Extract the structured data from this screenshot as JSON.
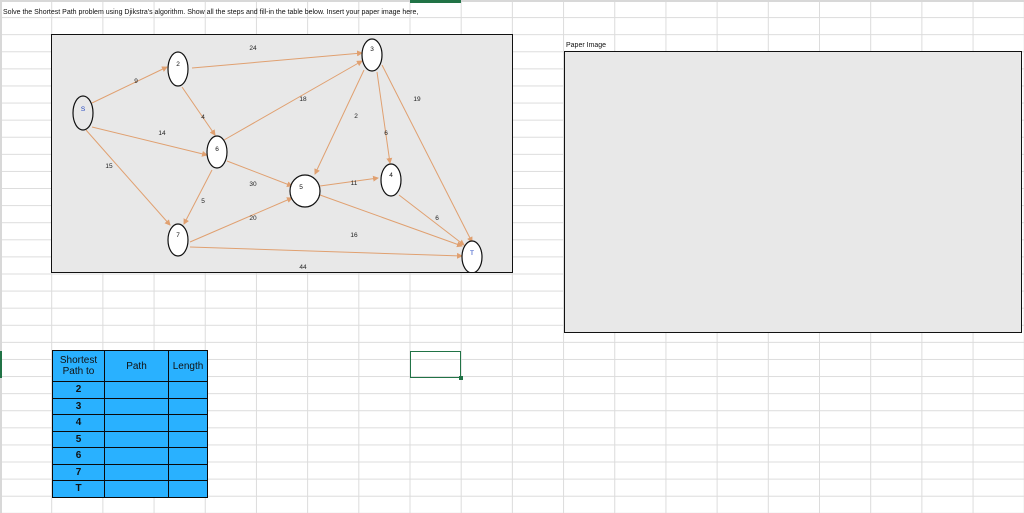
{
  "instructions": "Solve the Shortest Path problem using Djikstra's algorithm.  Show all the steps and fill-in the table below.  Insert your paper image here,",
  "paper_label": "Paper Image",
  "graph": {
    "nodes": {
      "s": "S",
      "n2": "2",
      "n3": "3",
      "n4": "4",
      "n5": "5",
      "n6": "6",
      "n7": "7",
      "t": "T"
    },
    "edges": {
      "s_2": "9",
      "s_6": "14",
      "s_7": "15",
      "2_3": "24",
      "2_6": "4",
      "3_5": "2",
      "3_t": "19",
      "3_4": "6",
      "6_3": "18",
      "6_5": "30",
      "6_7": "5",
      "7_5": "20",
      "7_t": "44",
      "5_4": "11",
      "5_t": "16",
      "4_t": "6"
    },
    "edge_color": "#e0a070",
    "node_label_color": "#1a3fbf"
  },
  "table": {
    "header": [
      "Shortest Path to",
      "Path",
      "Length"
    ],
    "rows": [
      "2",
      "3",
      "4",
      "5",
      "6",
      "7",
      "T"
    ]
  },
  "colors": {
    "table_fill": "#29b1ff",
    "selection": "#217346"
  }
}
